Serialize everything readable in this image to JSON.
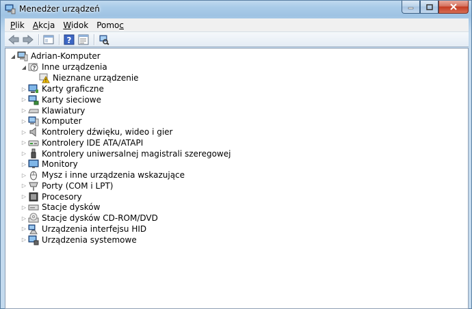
{
  "window": {
    "title": "Menedżer urządzeń"
  },
  "menubar": {
    "items": [
      {
        "label": "Plik",
        "ul": "P",
        "rest": "lik"
      },
      {
        "label": "Akcja",
        "ul": "A",
        "rest": "kcja"
      },
      {
        "label": "Widok",
        "ul": "W",
        "rest": "idok"
      },
      {
        "label": "Pomoc",
        "pre": "Pomo",
        "ul": "c"
      }
    ]
  },
  "toolbar": {
    "buttons": [
      "back-icon",
      "forward-icon",
      "console-tree-icon",
      "help-icon",
      "properties-icon",
      "scan-hardware-icon"
    ]
  },
  "tree": {
    "root": "Adrian-Komputer",
    "other_devices": "Inne urządzenia",
    "unknown_device": "Nieznane urządzenie",
    "categories": [
      "Karty graficzne",
      "Karty sieciowe",
      "Klawiatury",
      "Komputer",
      "Kontrolery dźwięku, wideo i gier",
      "Kontrolery IDE ATA/ATAPI",
      "Kontrolery uniwersalnej magistrali szeregowej",
      "Monitory",
      "Mysz i inne urządzenia wskazujące",
      "Porty (COM i LPT)",
      "Procesory",
      "Stacje dysków",
      "Stacje dysków CD-ROM/DVD",
      "Urządzenia interfejsu HID",
      "Urządzenia systemowe"
    ]
  },
  "colors": {
    "accent": "#6fa1c9",
    "warning": "#f4c20d"
  }
}
